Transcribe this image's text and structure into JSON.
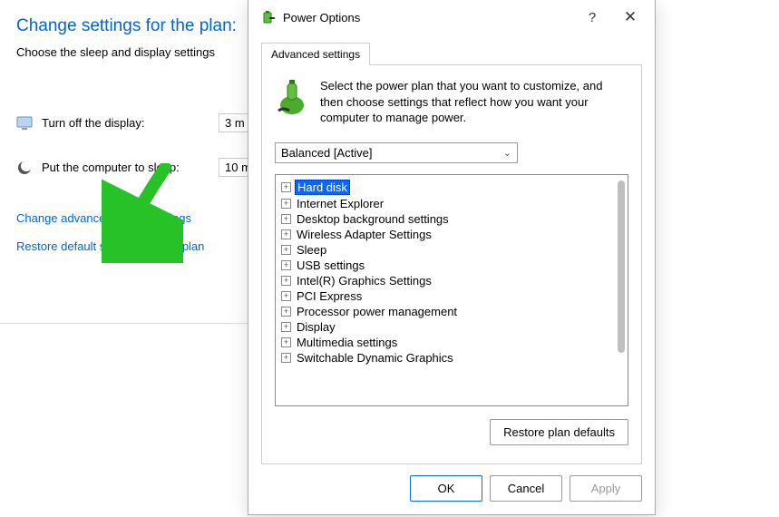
{
  "settings_page": {
    "title": "Change settings for the plan:",
    "subtitle": "Choose the sleep and display settings",
    "rows": [
      {
        "label": "Turn off the display:",
        "value": "3 m"
      },
      {
        "label": "Put the computer to sleep:",
        "value": "10 m"
      }
    ],
    "links": {
      "advanced": "Change advanced power settings",
      "restore": "Restore default settings for this plan"
    }
  },
  "dialog": {
    "title": "Power Options",
    "help_label": "?",
    "close_label": "✕",
    "tab_label": "Advanced settings",
    "intro": "Select the power plan that you want to customize, and then choose settings that reflect how you want your computer to manage power.",
    "plan_selected": "Balanced [Active]",
    "tree": [
      {
        "label": "Hard disk",
        "selected": true
      },
      {
        "label": "Internet Explorer"
      },
      {
        "label": "Desktop background settings"
      },
      {
        "label": "Wireless Adapter Settings"
      },
      {
        "label": "Sleep"
      },
      {
        "label": "USB settings"
      },
      {
        "label": "Intel(R) Graphics Settings"
      },
      {
        "label": "PCI Express"
      },
      {
        "label": "Processor power management"
      },
      {
        "label": "Display"
      },
      {
        "label": "Multimedia settings"
      },
      {
        "label": "Switchable Dynamic Graphics"
      }
    ],
    "restore_defaults": "Restore plan defaults",
    "buttons": {
      "ok": "OK",
      "cancel": "Cancel",
      "apply": "Apply"
    }
  }
}
